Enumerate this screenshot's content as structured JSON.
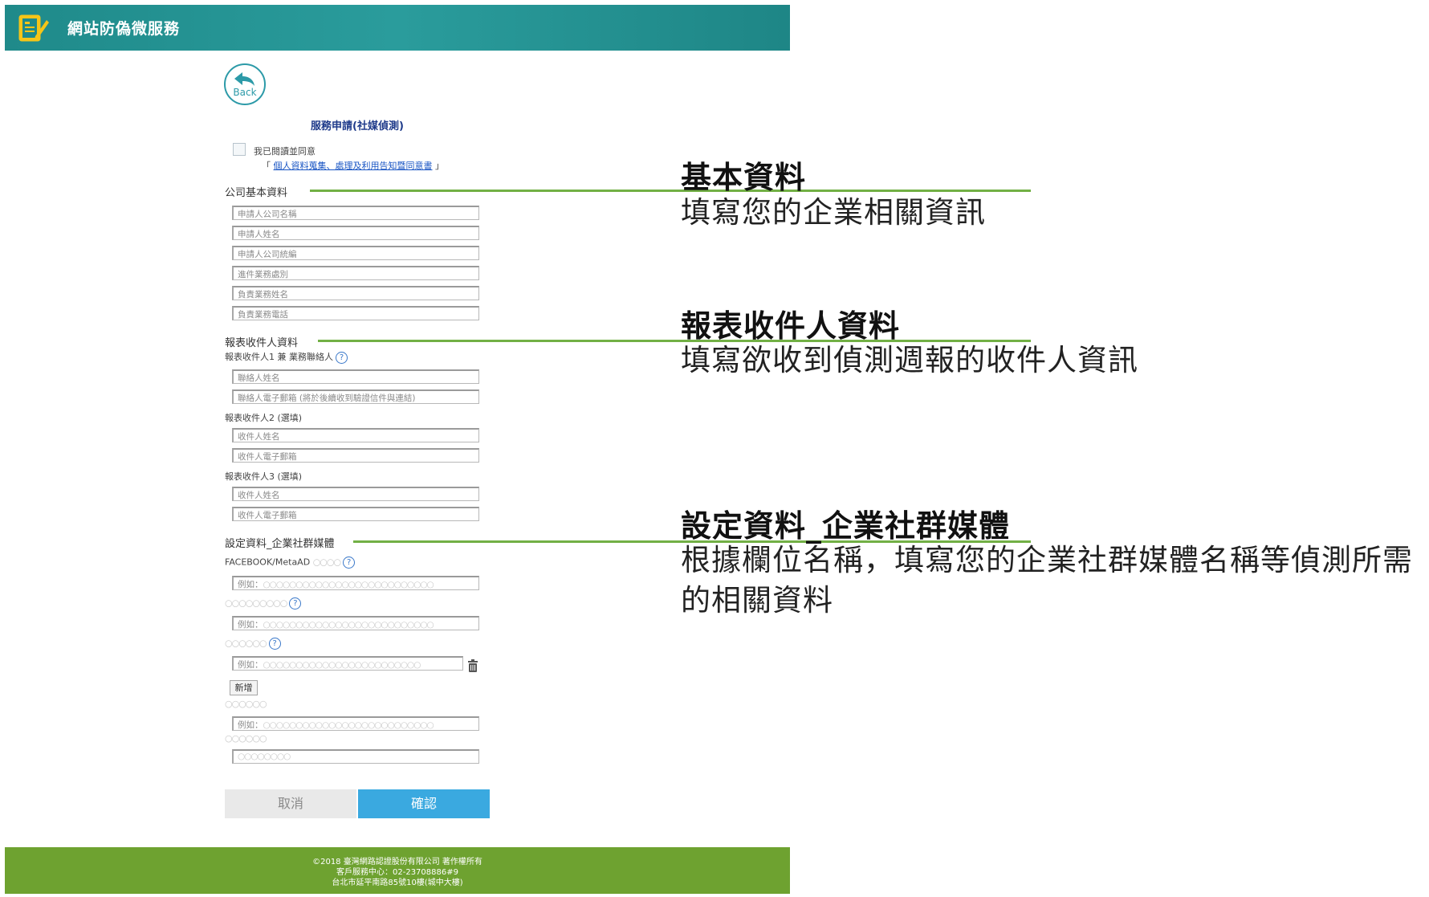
{
  "header": {
    "title": "網站防偽微服務"
  },
  "back": {
    "label": "Back"
  },
  "form": {
    "title": "服務申請(社媒偵測)",
    "agree_text": "我已閱讀並同意",
    "agree_link_open": "「",
    "agree_link": "個人資料蒐集、處理及利用告知暨同意書",
    "agree_link_close": "」",
    "company_section": "公司基本資料",
    "company_fields": [
      "申請人公司名稱",
      "申請人姓名",
      "申請人公司統編",
      "進件業務處別",
      "負責業務姓名",
      "負責業務電話"
    ],
    "recipient_section": "報表收件人資料",
    "recipient1_label": "報表收件人1 兼 業務聯絡人",
    "recipient1_fields": [
      "聯絡人姓名",
      "聯絡人電子郵箱 (將於後續收到驗證信件與連結)"
    ],
    "recipient2_label": "報表收件人2 (選填)",
    "recipient2_fields": [
      "收件人姓名",
      "收件人電子郵箱"
    ],
    "recipient3_label": "報表收件人3 (選填)",
    "recipient3_fields": [
      "收件人姓名",
      "收件人電子郵箱"
    ],
    "social_section": "設定資料_企業社群媒體",
    "facebook_label": "FACEBOOK/MetaAD",
    "example_prefix": "例如：",
    "add_button": "新增",
    "cancel_button": "取消",
    "confirm_button": "確認"
  },
  "footer": {
    "line1": "©2018 臺灣網路認證股份有限公司 著作權所有",
    "line2": "客戶服務中心：02-2370888​6#9",
    "line3": "台北市延平南路85號10樓(城中大樓)"
  },
  "annotations": [
    {
      "title": "基本資料",
      "desc": "填寫您的企業相關資訊"
    },
    {
      "title": "報表收件人資料",
      "desc": "填寫欲收到偵測週報的收件人資訊"
    },
    {
      "title": "設定資料_企業社群媒體",
      "desc": "根據欄位名稱，填寫您的企業社群媒體名稱等偵測所需的相關資料"
    }
  ],
  "colors": {
    "header": "#1f8a8a",
    "footer": "#6ea230",
    "confirm": "#3aa9e0",
    "leader": "#72b045",
    "link": "#1a56c4"
  }
}
